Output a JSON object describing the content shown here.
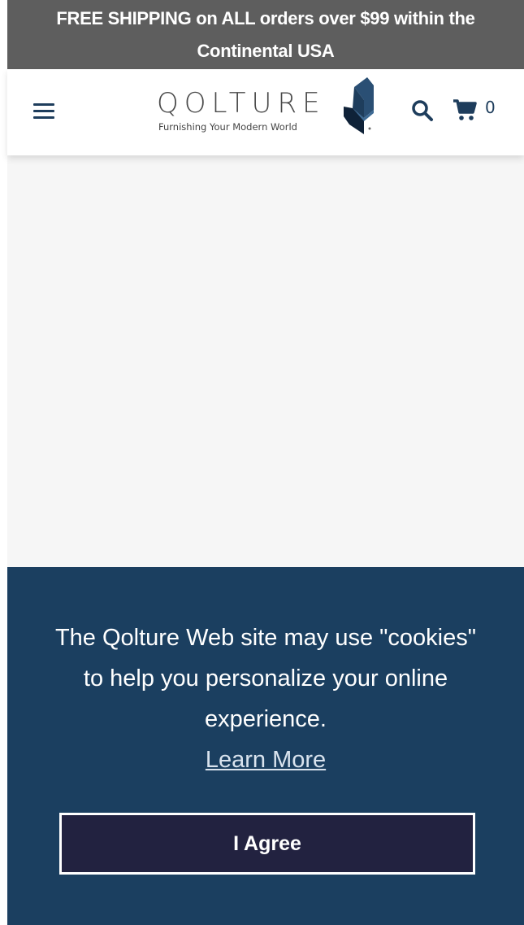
{
  "promo": {
    "line1": "FREE SHIPPING on ALL orders over $99 within the",
    "line2": "Continental USA"
  },
  "header": {
    "logo_word": "QOLTURE",
    "logo_tagline": "Furnishing Your Modern World",
    "cart_count": "0",
    "icons": [
      "hamburger-menu-icon",
      "search-icon",
      "cart-icon"
    ]
  },
  "cookie_banner": {
    "message": "The Qolture Web site may use \"cookies\" to help you personalize your online experience.",
    "learn_more": "Learn More",
    "agree_label": "I Agree"
  },
  "colors": {
    "promo_bg": "#5e5e5e",
    "brand_navy": "#1e3d5c",
    "banner_bg": "#1b3f60",
    "button_bg": "#222240",
    "content_bg": "#f6f6f6"
  }
}
